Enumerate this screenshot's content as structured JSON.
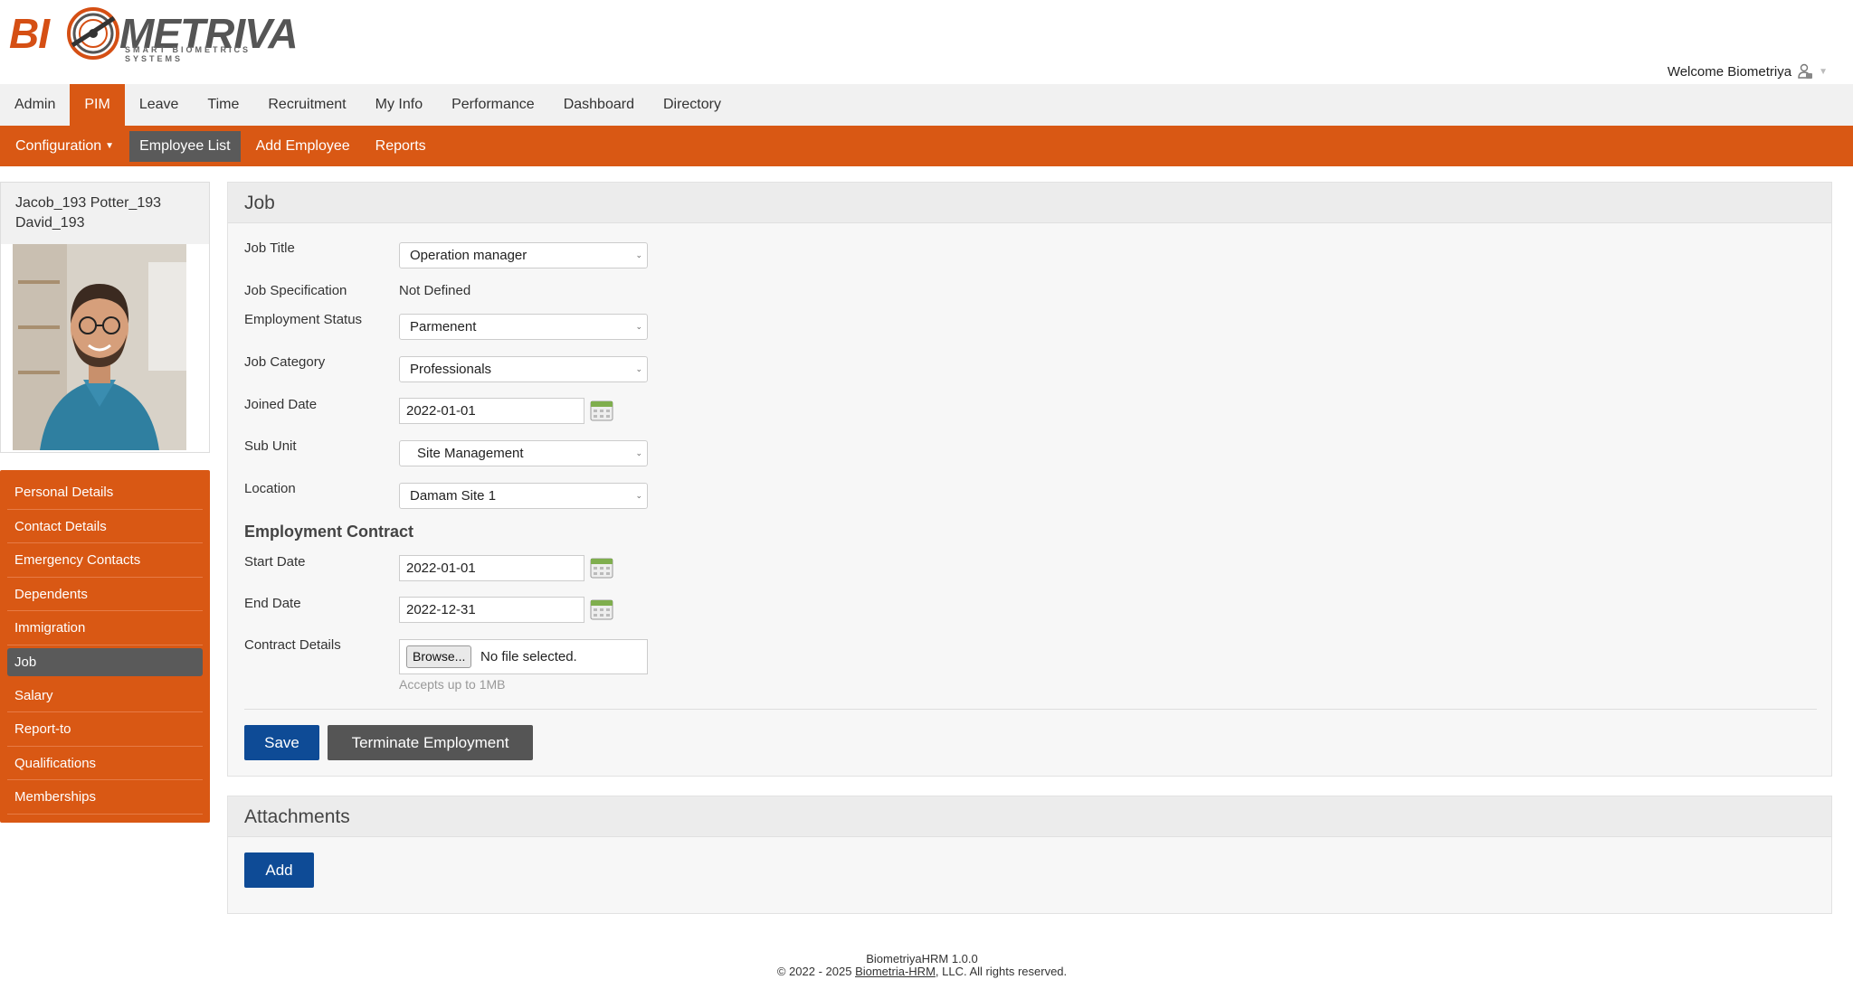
{
  "brand": {
    "logo_text_left": "BI",
    "logo_text_right": "METRIVA",
    "logo_tagline": "SMART BIOMETRICS SYSTEMS",
    "welcome": "Welcome Biometriya",
    "user_icon": "user-lock-icon",
    "accent_color": "#d95814"
  },
  "main_nav": {
    "tabs": [
      {
        "label": "Admin"
      },
      {
        "label": "PIM"
      },
      {
        "label": "Leave"
      },
      {
        "label": "Time"
      },
      {
        "label": "Recruitment"
      },
      {
        "label": "My Info"
      },
      {
        "label": "Performance"
      },
      {
        "label": "Dashboard"
      },
      {
        "label": "Directory"
      }
    ],
    "active": "PIM"
  },
  "sub_nav": {
    "items": [
      {
        "label": "Configuration"
      },
      {
        "label": "Employee List"
      },
      {
        "label": "Add Employee"
      },
      {
        "label": "Reports"
      }
    ],
    "active": "Employee List"
  },
  "employee": {
    "name_line1": "Jacob_193 Potter_193",
    "name_line2": "David_193"
  },
  "side_menu": {
    "items": [
      {
        "label": "Personal Details"
      },
      {
        "label": "Contact Details"
      },
      {
        "label": "Emergency Contacts"
      },
      {
        "label": "Dependents"
      },
      {
        "label": "Immigration"
      },
      {
        "label": "Job"
      },
      {
        "label": "Salary"
      },
      {
        "label": "Report-to"
      },
      {
        "label": "Qualifications"
      },
      {
        "label": "Memberships"
      }
    ],
    "active": "Job"
  },
  "job": {
    "title": "Job",
    "fields": {
      "job_title": {
        "label": "Job Title",
        "value": "Operation manager"
      },
      "job_spec": {
        "label": "Job Specification",
        "value": "Not Defined"
      },
      "employment_status": {
        "label": "Employment Status",
        "value": "Parmenent"
      },
      "job_category": {
        "label": "Job Category",
        "value": "Professionals"
      },
      "joined_date": {
        "label": "Joined Date",
        "value": "2022-01-01"
      },
      "sub_unit": {
        "label": "Sub Unit",
        "value": "Site Management"
      },
      "location": {
        "label": "Location",
        "value": "Damam Site 1"
      }
    },
    "contract": {
      "heading": "Employment Contract",
      "start_date": {
        "label": "Start Date",
        "value": "2022-01-01"
      },
      "end_date": {
        "label": "End Date",
        "value": "2022-12-31"
      },
      "details": {
        "label": "Contract Details",
        "browse": "Browse...",
        "status": "No file selected.",
        "hint": "Accepts up to 1MB"
      }
    },
    "save": "Save",
    "terminate": "Terminate Employment"
  },
  "attachments": {
    "title": "Attachments",
    "add": "Add"
  },
  "footer": {
    "version": "BiometriyaHRM 1.0.0",
    "copyright_prefix": "© 2022 - 2025",
    "company_link": "Biometria-HRM",
    "copyright_suffix": ", LLC. All rights reserved."
  }
}
